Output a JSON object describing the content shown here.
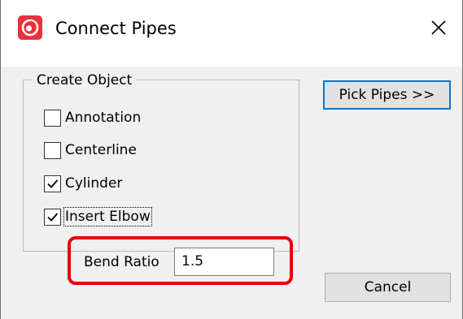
{
  "window": {
    "title": "Connect Pipes"
  },
  "group": {
    "title": "Create Object",
    "checkboxes": [
      {
        "label": "Annotation",
        "checked": false
      },
      {
        "label": "Centerline",
        "checked": false
      },
      {
        "label": "Cylinder",
        "checked": true
      },
      {
        "label": "Insert Elbow",
        "checked": true,
        "focused": true
      }
    ]
  },
  "bend_ratio": {
    "label": "Bend Ratio",
    "value": "1.5"
  },
  "buttons": {
    "pick_pipes": "Pick Pipes >>",
    "cancel": "Cancel"
  },
  "colors": {
    "highlight": "#e3000b",
    "app_icon": "#e8323c",
    "default_button_border": "#0078d7"
  },
  "icons": {
    "app": "app-logo-icon",
    "close": "close-icon",
    "check": "checkmark-icon"
  }
}
